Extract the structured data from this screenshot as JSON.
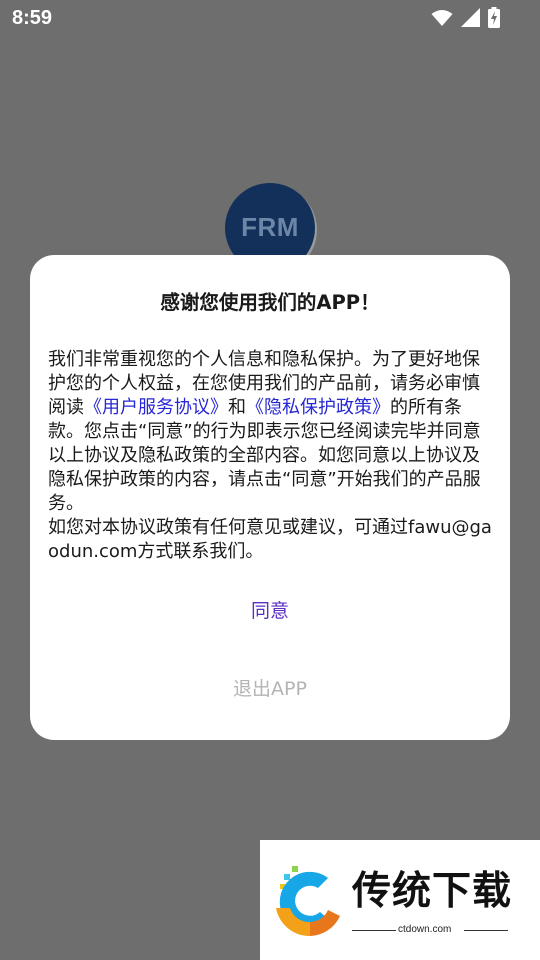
{
  "status_bar": {
    "time": "8:59"
  },
  "background_app": {
    "logo_text": "FRM"
  },
  "dialog": {
    "title": "感谢您使用我们的APP！",
    "body": {
      "text_1": "我们非常重视您的个人信息和隐私保护。为了更好地保护您的个人权益，在您使用我们的产品前，请务必审慎阅读",
      "link_user_agreement": "《用户服务协议》",
      "text_2": "和",
      "link_privacy_policy": "《隐私保护政策》",
      "text_3": "的所有条款。您点击“同意”的行为即表示您已经阅读完毕并同意以上协议及隐私政策的全部内容。如您同意以上协议及隐私保护政策的内容，请点击“同意”开始我们的产品服务。",
      "text_4": "如您对本协议政策有任何意见或建议，可通过fawu@gaodun.com方式联系我们。"
    },
    "agree_label": "同意",
    "exit_label": "退出APP"
  },
  "watermark": {
    "brand": "传统下载",
    "url": "ctdown.com"
  },
  "colors": {
    "scrim": "#6e6e6e",
    "link": "#2727d6",
    "agree": "#5a2fc2",
    "exit": "#b4b4b4"
  },
  "icons": [
    "wifi-icon",
    "cell-signal-icon",
    "battery-charging-icon"
  ]
}
